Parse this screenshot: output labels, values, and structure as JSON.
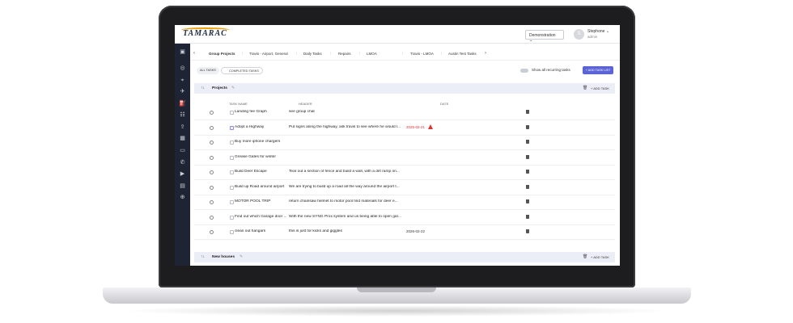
{
  "app": {
    "logo": "TAMARAC"
  },
  "topbar": {
    "account_select": "Demonstration",
    "user_initial": "S",
    "user_name": "Stephone",
    "user_role": "admin"
  },
  "tabs": [
    {
      "label": "Group Projects",
      "active": true
    },
    {
      "label": "Travis - Airport, General"
    },
    {
      "label": "Daily Tasks"
    },
    {
      "label": "Repairs"
    },
    {
      "label": "LMOA"
    },
    {
      "label": "Travis - LMOA"
    },
    {
      "label": "Austin Test Tasks"
    }
  ],
  "filters": {
    "all_tasks": "ALL TASKS",
    "completed_tasks": "COMPLETED TASKS",
    "show_recurring": "Show all recurring tasks",
    "add_task_list": "+ ADD TASK LIST"
  },
  "groups": [
    {
      "title": "Projects",
      "add_task": "+ ADD TASK"
    },
    {
      "title": "New houses",
      "add_task": "+ ADD TASK"
    }
  ],
  "columns": {
    "task_name": "TASK NAME",
    "header": "HEADER",
    "date": "DATE"
  },
  "rows": [
    {
      "name": "Landing fee Graph",
      "header": "see group chat",
      "date": ""
    },
    {
      "name": "Adopt a Highway",
      "header": "Put signs along the highway, ask travis to see where he would l...",
      "date": "2025-02-21",
      "overdue": true
    },
    {
      "name": "Buy more iphone chargers",
      "header": "",
      "date": ""
    },
    {
      "name": "Grease Gates for winter",
      "header": "",
      "date": ""
    },
    {
      "name": "Build Deer Escape",
      "header": "Tear out a section of fence and build a wall, with a dirt ramp on...",
      "date": ""
    },
    {
      "name": "Build up Road around airport",
      "header": "We are trying to build up a road all the way around the airport t...",
      "date": ""
    },
    {
      "name": "MOTOR POOL TRIP",
      "header": "return chainsaw helmet to motor pool find materials for deer e...",
      "date": ""
    },
    {
      "name": "Find out which Garage door ...",
      "header": "With the new SYNG Prox system and us being able to open gar...",
      "date": ""
    },
    {
      "name": "clean out hangars",
      "header": "this is just for kicks and giggles",
      "date": "2026-02-22"
    }
  ],
  "colors": {
    "rail": "#1e2433",
    "accent": "#5b63d6",
    "overdue": "#e03131",
    "group_bg": "#eceef7"
  }
}
